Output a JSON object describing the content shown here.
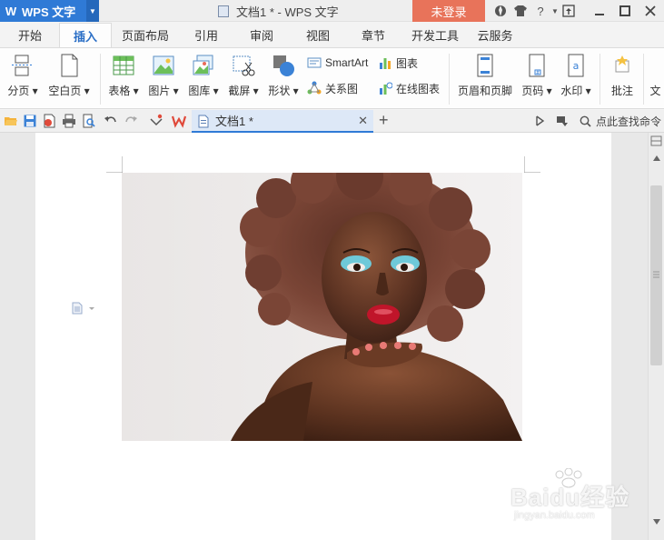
{
  "app": {
    "name": "WPS 文字"
  },
  "window": {
    "title": "文档1 * - WPS 文字",
    "login_label": "未登录"
  },
  "tabs": [
    "开始",
    "插入",
    "页面布局",
    "引用",
    "审阅",
    "视图",
    "章节",
    "开发工具",
    "云服务"
  ],
  "ribbon": {
    "page_break": "分页",
    "blank_page": "空白页",
    "table": "表格",
    "picture": "图片",
    "gallery": "图库",
    "screenshot": "截屏",
    "shape": "形状",
    "smartart": "SmartArt",
    "chart": "图表",
    "relation": "关系图",
    "online_chart": "在线图表",
    "header_footer": "页眉和页脚",
    "page_number": "页码",
    "watermark": "水印",
    "comment": "批注",
    "text_partial": "文"
  },
  "document_tab": {
    "name": "文档1 *"
  },
  "search": {
    "label": "点此查找命令"
  },
  "watermark_overlay": {
    "main": "Baidu经验",
    "sub": "jingyan.baidu.com"
  },
  "colors": {
    "accent": "#2f7ad6",
    "login": "#e8735a"
  }
}
